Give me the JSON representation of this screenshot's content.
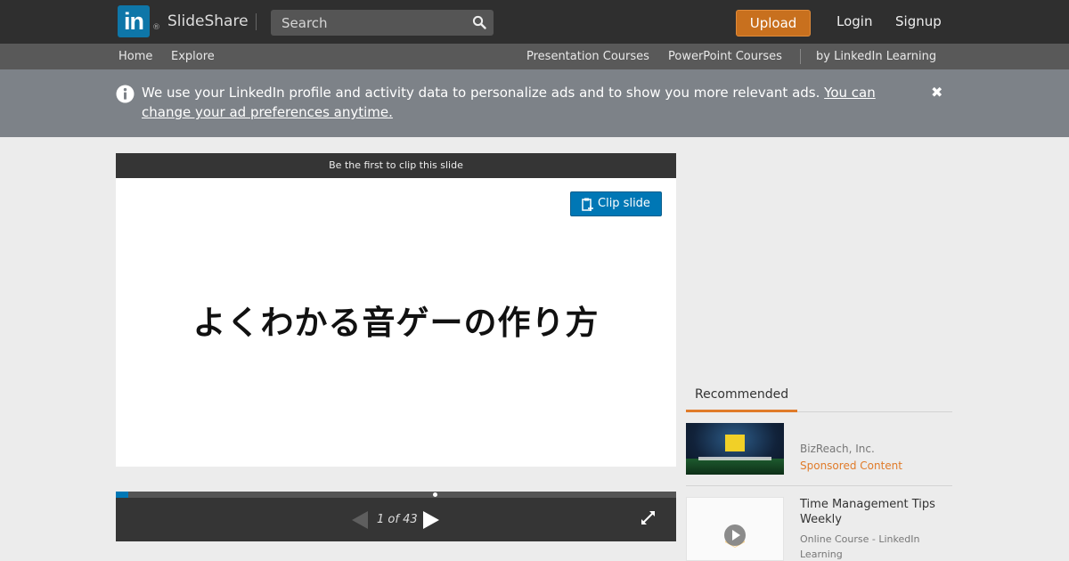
{
  "header": {
    "logo_text": "in",
    "logo_mark": "®",
    "brand": "SlideShare",
    "search_placeholder": "Search",
    "upload_label": "Upload",
    "login_label": "Login",
    "signup_label": "Signup"
  },
  "subnav": {
    "home": "Home",
    "explore": "Explore",
    "presentation_courses": "Presentation Courses",
    "powerpoint_courses": "PowerPoint Courses",
    "by_linkedin_learning": "by LinkedIn Learning"
  },
  "notice": {
    "text": "We use your LinkedIn profile and activity data to personalize ads and to show you more relevant ads.",
    "link": "You can change your ad preferences anytime.",
    "close": "✖"
  },
  "player": {
    "clip_prompt": "Be the first to clip this slide",
    "clip_button": "Clip slide",
    "slide_title": "よくわかる音ゲーの作り方",
    "current_page": 1,
    "total_pages": 43,
    "page_indicator": "1 of 43",
    "progress_fraction": 0.023
  },
  "sidebar": {
    "tab_label": "Recommended",
    "items": [
      {
        "author": "BizReach, Inc.",
        "badge": "Sponsored Content"
      },
      {
        "title": "Time Management Tips Weekly",
        "source": "Online Course - LinkedIn Learning"
      }
    ]
  },
  "colors": {
    "topbar": "#2f2f2f",
    "subnav": "#595959",
    "notice": "#7d8288",
    "upload": "#c8701e",
    "linkedin_blue": "#0077b5",
    "accent_orange": "#e07b2a"
  },
  "icons": [
    "linkedin-logo",
    "search-icon",
    "info-icon",
    "close-icon",
    "clip-icon",
    "previous-icon",
    "next-icon",
    "fullscreen-icon",
    "play-icon"
  ]
}
